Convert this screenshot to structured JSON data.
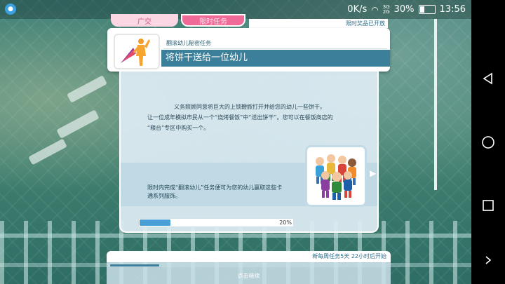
{
  "status_bar": {
    "net_speed": "0K/s",
    "net_labels": [
      "3G",
      "2G"
    ],
    "battery": "30%",
    "time": "13:56"
  },
  "tabs": [
    {
      "label": "广交"
    },
    {
      "label": "限时任务"
    }
  ],
  "top_notice": "限时奖品已开放",
  "header": {
    "subtitle": "翻滚幼儿秘密任务",
    "title": "将饼干送给一位幼儿"
  },
  "description": {
    "line1": "义务照顾同意将巨大的上锁鞭掀打开并给您的幼儿一些饼干。",
    "line2": "让一位成年模拟市民从一个“烧烤餐饭”中“送出饼干”。您可以在餐饭商店的",
    "line3": "“粮台”专区中购买一个。"
  },
  "reward": {
    "text": "限时内完成“翻滚幼儿”任务便可为您的幼儿赢取这些卡通系列服饰。"
  },
  "progress": {
    "value": 20,
    "label": "20%"
  },
  "bottom": {
    "next_task": "新每周任务5天 22小时后开始",
    "continue_label": "点击继续"
  },
  "colors": {
    "accent_pink": "#ef6a96",
    "title_teal": "#3b7f9a",
    "progress_blue": "#4a9fd6"
  }
}
